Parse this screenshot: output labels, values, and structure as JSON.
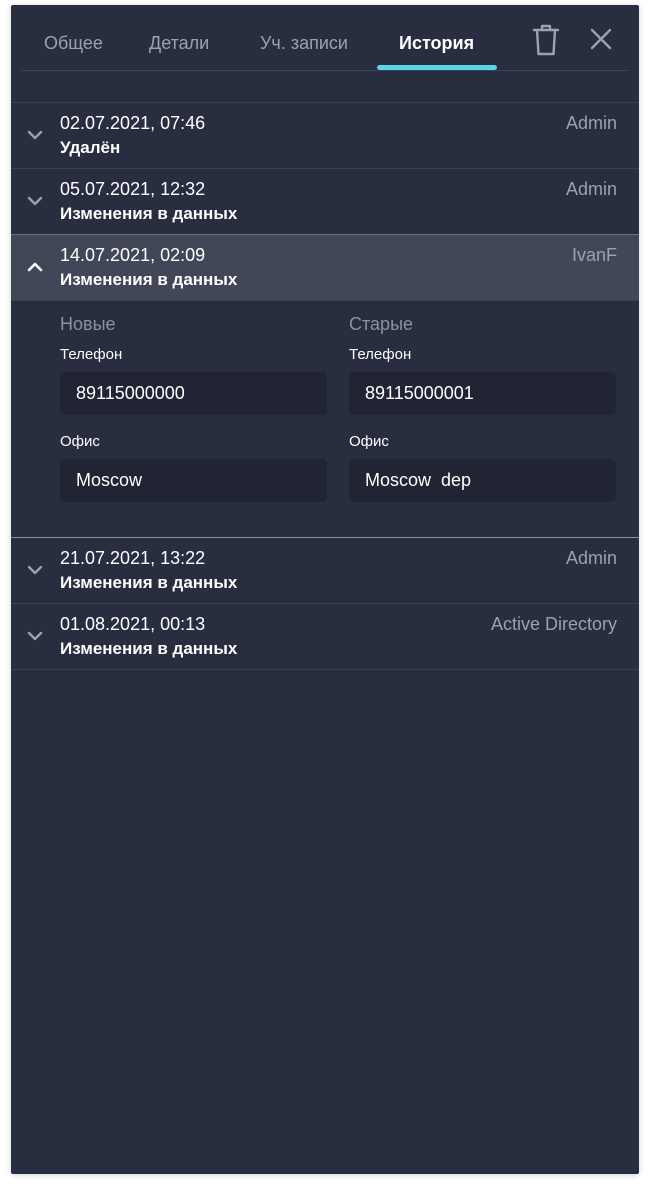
{
  "tabs": [
    {
      "label": "Общее"
    },
    {
      "label": "Детали"
    },
    {
      "label": "Уч. записи"
    },
    {
      "label": "История"
    }
  ],
  "active_tab": "История",
  "icons": {
    "delete": "trash-icon",
    "close": "close-icon",
    "collapsed": "chevron-down-icon",
    "expanded": "chevron-up-icon"
  },
  "colors": {
    "panel_bg": "#282d3f",
    "accent": "#5ad4e6",
    "expanded_row": "#414757",
    "field_bg": "#202433"
  },
  "history": [
    {
      "date": "02.07.2021, 07:46",
      "title": "Удалён",
      "user": "Admin",
      "expanded": false
    },
    {
      "date": "05.07.2021, 12:32",
      "title": "Изменения в данных",
      "user": "Admin",
      "expanded": false
    },
    {
      "date": "14.07.2021, 02:09",
      "title": "Изменения в данных",
      "user": "IvanF",
      "expanded": true
    },
    {
      "date": "21.07.2021, 13:22",
      "title": "Изменения в данных",
      "user": "Admin",
      "expanded": false
    },
    {
      "date": "01.08.2021, 00:13",
      "title": "Изменения в данных",
      "user": "Active Directory",
      "expanded": false
    }
  ],
  "details": {
    "new_header": "Новые",
    "old_header": "Старые",
    "fields": [
      {
        "label": "Телефон",
        "new_value": "89115000000",
        "old_value": "89115000001"
      },
      {
        "label": "Офис",
        "new_value": "Moscow",
        "old_value": "Moscow  dep"
      }
    ]
  }
}
